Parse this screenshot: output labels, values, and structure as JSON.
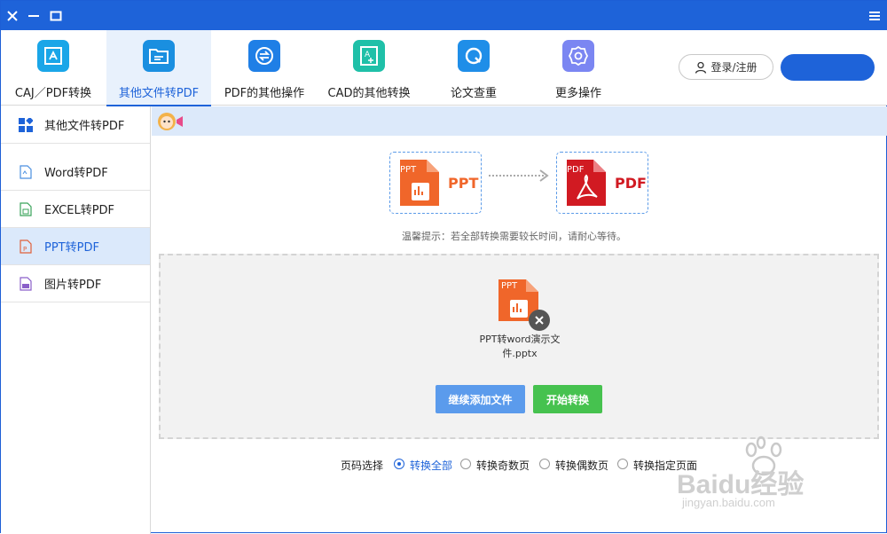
{
  "titlebar": {
    "close_glyph": "✕",
    "minimize_glyph": "—",
    "maximize_glyph": "▭",
    "menu_glyph": "≡"
  },
  "toolbar": {
    "tools": [
      {
        "label": "CAJ／PDF转换",
        "icon": "caj-pdf-icon",
        "color": "#1aa6e8"
      },
      {
        "label": "其他文件转PDF",
        "icon": "folder-icon",
        "color": "#1a8fe0",
        "active": true
      },
      {
        "label": "PDF的其他操作",
        "icon": "swap-icon",
        "color": "#1f7fe6"
      },
      {
        "label": "CAD的其他转换",
        "icon": "cad-icon",
        "color": "#1fc0a8"
      },
      {
        "label": "论文查重",
        "icon": "search-q-icon",
        "color": "#1f8ee8"
      },
      {
        "label": "更多操作",
        "icon": "gear-icon",
        "color": "#7b86f2"
      }
    ],
    "login_label": "登录/注册"
  },
  "sidebar": {
    "items": [
      {
        "label": "其他文件转PDF",
        "icon": "grid-icon"
      },
      {
        "label": "Word转PDF",
        "icon": "word-file-icon"
      },
      {
        "label": "EXCEL转PDF",
        "icon": "excel-file-icon"
      },
      {
        "label": "PPT转PDF",
        "icon": "ppt-file-icon",
        "active": true
      },
      {
        "label": "图片转PDF",
        "icon": "jpg-file-icon"
      }
    ]
  },
  "converter": {
    "from_label": "PPT",
    "to_label": "PDF",
    "from_badge": "PPT",
    "to_badge": "PDF",
    "tip": "温馨提示：若全部转换需要较长时间，请耐心等待。"
  },
  "file": {
    "badge": "PPT",
    "name_line1": "PPT转word演示文",
    "name_line2": "件.pptx"
  },
  "buttons": {
    "add_more": "继续添加文件",
    "start": "开始转换"
  },
  "pages": {
    "label": "页码选择",
    "options": [
      "转换全部",
      "转换奇数页",
      "转换偶数页",
      "转换指定页面"
    ],
    "selected": "转换全部"
  },
  "watermark": {
    "text": "Baidu经验",
    "url": "jingyan.baidu.com"
  }
}
